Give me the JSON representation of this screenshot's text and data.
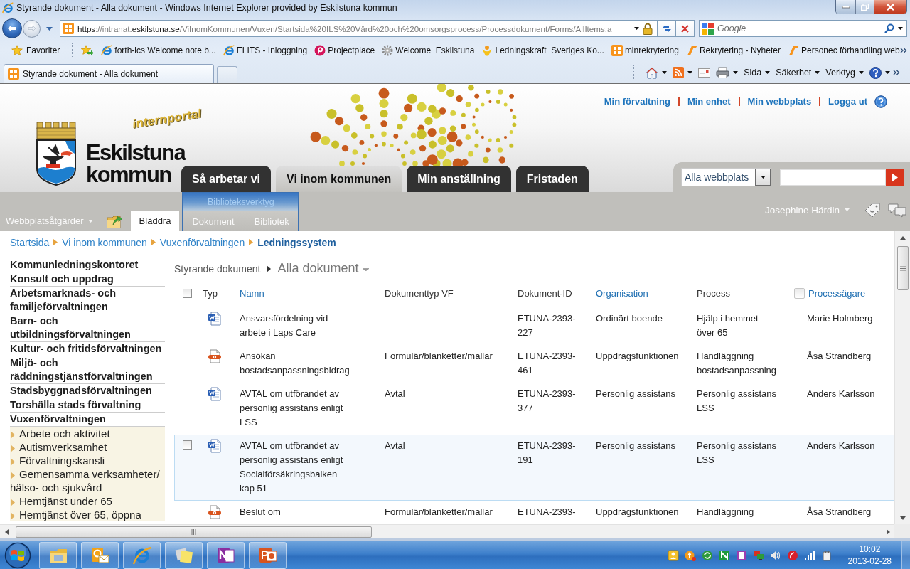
{
  "browser": {
    "title": "Styrande dokument - Alla dokument - Windows Internet Explorer provided by Eskilstuna kommun",
    "address": [
      {
        "text": "https",
        "strong": true
      },
      {
        "text": "://intranat.",
        "strong": false
      },
      {
        "text": "eskilstuna.se",
        "strong": true
      },
      {
        "text": "/ViInomKommunen/Vuxen/Startsida%20ILS%20Vård%20och%20omsorgsprocess/Processdokument/Forms/AllItems.a",
        "strong": false
      }
    ],
    "search": {
      "placeholder": "Google"
    },
    "favorites_label": "Favoriter",
    "favorites": [
      {
        "label": "forth-ics Welcome note b...",
        "kind": "ie"
      },
      {
        "label": "ELITS - Inloggning",
        "kind": "ie"
      },
      {
        "label": "Projectplace",
        "kind": "projectplace"
      },
      {
        "label": "Welcome  Eskilstuna",
        "kind": "web"
      },
      {
        "label": "Ledningskraft  Sveriges Ko...",
        "kind": "ledningskraft"
      },
      {
        "label": "minrekrytering",
        "kind": "sharepoint"
      },
      {
        "label": "Rekrytering - Nyheter",
        "kind": "personec"
      },
      {
        "label": "Personec förhandling web",
        "kind": "personec"
      }
    ],
    "tabs": [
      {
        "label": "Styrande dokument - Alla dokument",
        "selected": true
      }
    ],
    "commands": [
      {
        "label": "Sida"
      },
      {
        "label": "Säkerhet"
      },
      {
        "label": "Verktyg"
      }
    ]
  },
  "portal": {
    "tagline": "internportal",
    "logo": [
      "Eskilstuna",
      "kommun"
    ],
    "top_links": [
      {
        "label": "Min förvaltning"
      },
      {
        "label": "Min enhet"
      },
      {
        "label": "Min webbplats"
      },
      {
        "label": "Logga ut"
      }
    ],
    "tabs": [
      {
        "label": "Så arbetar vi",
        "selected": false
      },
      {
        "label": "Vi inom kommunen",
        "selected": true
      },
      {
        "label": "Min anställning",
        "selected": false
      },
      {
        "label": "Fristaden",
        "selected": false
      }
    ],
    "search": {
      "scope": "Alla webbplats"
    }
  },
  "ribbon": {
    "site_actions": "Webbplatsåtgärder",
    "tabs": [
      {
        "label": "Bläddra",
        "selected": true
      }
    ],
    "tool_group": {
      "label": "Biblioteksverktyg",
      "tabs": [
        {
          "label": "Dokument",
          "selected": false
        },
        {
          "label": "Bibliotek",
          "selected": false
        }
      ]
    },
    "user": "Josephine Härdin"
  },
  "breadcrumb": [
    {
      "label": "Startsida",
      "current": false
    },
    {
      "label": "Vi inom kommunen",
      "current": false
    },
    {
      "label": "Vuxenförvaltningen",
      "current": false
    },
    {
      "label": "Ledningssystem",
      "current": true
    }
  ],
  "quick_launch": [
    {
      "label": "Kommunledningskontoret"
    },
    {
      "label": "Konsult och uppdrag"
    },
    {
      "label": "Arbetsmarknads- och familjeförvaltningen"
    },
    {
      "label": "Barn- och utbildningsförvaltningen"
    },
    {
      "label": "Kultur- och fritidsförvaltningen"
    },
    {
      "label": "Miljö- och räddningstjänstförvaltningen"
    },
    {
      "label": "Stadsbyggnadsförvaltningen"
    },
    {
      "label": "Torshälla stads förvaltning"
    },
    {
      "label": "Vuxenförvaltningen",
      "children": [
        {
          "label": "Arbete och aktivitet"
        },
        {
          "label": "Autismverksamhet"
        },
        {
          "label": "Förvaltningskansli"
        },
        {
          "label": "Gemensamma verksamheter/ hälso- och sjukvård"
        },
        {
          "label": "Hemtjänst under 65"
        },
        {
          "label": "Hemtjänst över 65, öppna"
        }
      ]
    }
  ],
  "view": {
    "list": "Styrande dokument",
    "name": "Alla dokument"
  },
  "table": {
    "select_all": {
      "checked": false
    },
    "columns": [
      {
        "label": "Typ",
        "link": false
      },
      {
        "label": "Namn",
        "link": true
      },
      {
        "label": "Dokumenttyp VF",
        "link": false
      },
      {
        "label": "Dokument-ID",
        "link": false
      },
      {
        "label": "Organisation",
        "link": true
      },
      {
        "label": "Process",
        "link": false
      },
      {
        "label": "Processägare",
        "link": true,
        "checkbox": {
          "checked": false
        }
      }
    ],
    "rows": [
      {
        "kind": "word",
        "highlighted": false,
        "checked": false,
        "name": "Ansvarsfördelning vid arbete i Laps Care",
        "doc_id": "ETUNA-2393-227",
        "organisation": "Ordinärt boende",
        "process": "Hjälp i hemmet över 65",
        "owner": "Marie Holmberg"
      },
      {
        "kind": "form",
        "highlighted": false,
        "checked": false,
        "name": "Ansökan bostadsanpassningsbidrag",
        "doc_type": "Formulär/blanketter/mallar",
        "doc_id": "ETUNA-2393-461",
        "organisation": "Uppdragsfunktionen",
        "process": "Handläggning bostadsanpassning",
        "owner": "Åsa Strandberg"
      },
      {
        "kind": "word",
        "highlighted": false,
        "checked": false,
        "name": "AVTAL om utförandet av personlig assistans enligt LSS",
        "doc_type": "Avtal",
        "doc_id": "ETUNA-2393-377",
        "organisation": "Personlig assistans",
        "process": "Personlig assistans LSS",
        "owner": "Anders Karlsson"
      },
      {
        "kind": "word",
        "highlighted": true,
        "checked": false,
        "name": "AVTAL om utförandet av personlig assistans enligt Socialförsäkringsbalken kap 51",
        "doc_type": "Avtal",
        "doc_id": "ETUNA-2393-191",
        "organisation": "Personlig assistans",
        "process": "Personlig assistans LSS",
        "owner": "Anders Karlsson"
      },
      {
        "kind": "form",
        "highlighted": false,
        "checked": false,
        "name": "Beslut om",
        "doc_type": "Formulär/blanketter/mallar",
        "doc_id": "ETUNA-2393-",
        "organisation": "Uppdragsfunktionen",
        "process": "Handläggning",
        "owner": "Åsa Strandberg"
      }
    ]
  },
  "taskbar": {
    "time": "10:02",
    "date": "2013-02-28"
  }
}
